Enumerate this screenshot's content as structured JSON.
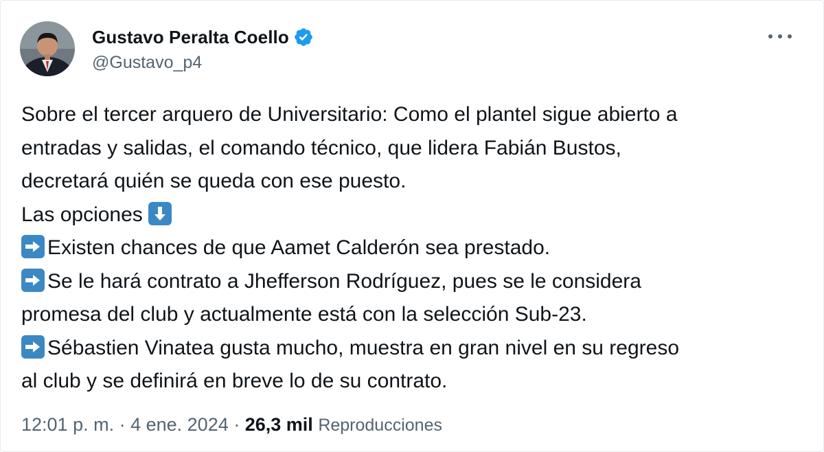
{
  "author": {
    "display_name": "Gustavo Peralta Coello",
    "handle": "@Gustavo_p4",
    "verified": true,
    "avatar_icon": "profile-photo"
  },
  "tweet": {
    "lines": [
      "Sobre el tercer arquero de Universitario: Como el plantel sigue abierto a",
      "entradas y salidas, el comando técnico, que lidera Fabián Bustos,",
      "decretará quién se queda con ese puesto.",
      "Las opciones",
      "Existen chances de que Aamet Calderón sea prestado.",
      "Se le hará contrato a Jhefferson Rodríguez, pues se le considera",
      "promesa del club y actualmente está con la selección Sub-23.",
      "Sébastien Vinatea gusta mucho, muestra en gran nivel en su regreso",
      "al club y se definirá en breve lo de su contrato."
    ],
    "emojis": {
      "down_arrow": "down-arrow-emoji",
      "right_arrow": "right-arrow-emoji"
    }
  },
  "meta": {
    "time": "12:01 p. m.",
    "separator": " · ",
    "date": "4 ene. 2024",
    "views_count": "26,3 mil",
    "views_label": "Reproducciones"
  },
  "colors": {
    "text": "#0f1419",
    "secondary": "#536471",
    "verified": "#1d9bf0",
    "emoji_blue": "#3b88c3"
  }
}
